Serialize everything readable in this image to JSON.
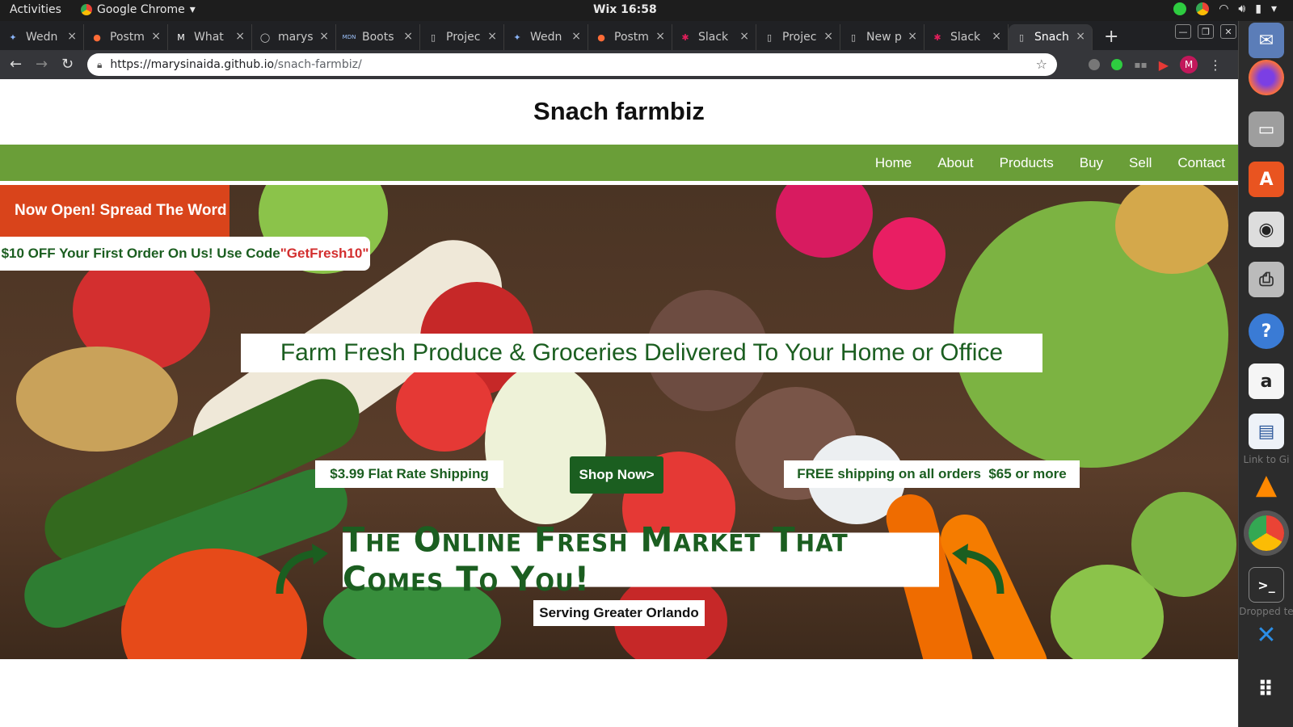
{
  "system_bar": {
    "activities": "Activities",
    "app_name": "Google Chrome",
    "clock": "Wix 16:58"
  },
  "browser": {
    "tabs": [
      {
        "label": "Wedn",
        "icon": "wix-icon",
        "active": false
      },
      {
        "label": "Postm",
        "icon": "postman-icon",
        "active": false
      },
      {
        "label": "What",
        "icon": "medium-icon",
        "active": false
      },
      {
        "label": "marys",
        "icon": "github-icon",
        "active": false
      },
      {
        "label": "Boots",
        "icon": "mdn-icon",
        "active": false
      },
      {
        "label": "Projec",
        "icon": "page-icon",
        "active": false
      },
      {
        "label": "Wedn",
        "icon": "wix-icon",
        "active": false
      },
      {
        "label": "Postm",
        "icon": "postman-icon",
        "active": false
      },
      {
        "label": "Slack",
        "icon": "slack-icon",
        "active": false
      },
      {
        "label": "Projec",
        "icon": "page-icon",
        "active": false
      },
      {
        "label": "New p",
        "icon": "page-icon",
        "active": false
      },
      {
        "label": "Slack",
        "icon": "slack-icon",
        "active": false
      },
      {
        "label": "Snach",
        "icon": "page-icon",
        "active": true
      }
    ],
    "url_host": "https://marysinaida.github.io",
    "url_path": "/snach-farmbiz/",
    "profile_initial": "M"
  },
  "dock": {
    "labels": [
      "Link to Gi",
      "Dropped te"
    ]
  },
  "site": {
    "title": "Snach farmbiz",
    "nav": [
      "Home",
      "About",
      "Products",
      "Buy",
      "Sell",
      "Contact"
    ],
    "hero": {
      "announcement": "Now Open! Spread The Word",
      "promo_prefix": "$10 OFF Your First Order On Us! Use Code ",
      "promo_code": "\"GetFresh10\"",
      "headline": "Farm Fresh Produce & Groceries Delivered To Your Home or Office",
      "flat_shipping": "$3.99 Flat Rate Shipping",
      "shop_button": "Shop Now>",
      "free_shipping": "FREE shipping on all orders  $65 or more",
      "tagline": "The Online Fresh Market That Comes To You!",
      "service_area": "Serving Greater Orlando"
    }
  }
}
